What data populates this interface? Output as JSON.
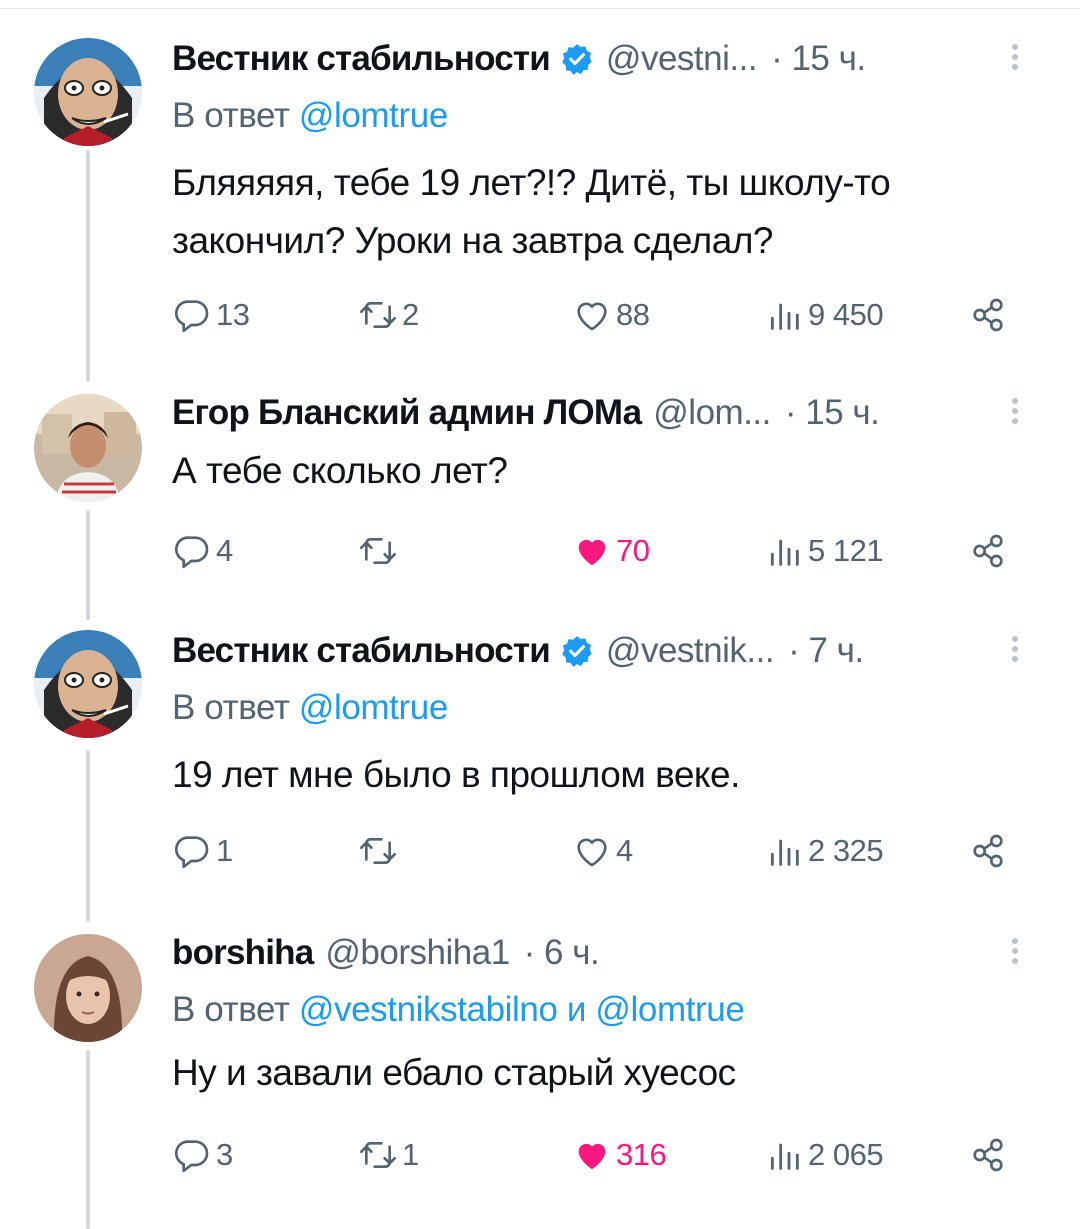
{
  "tweets": [
    {
      "name": "Вестник стабильности",
      "verified": true,
      "handle": "@vestni...",
      "time": "· 15 ч.",
      "reply_prefix": "В ответ",
      "reply_mentions": "@lomtrue",
      "reply_joiner": "",
      "reply_mentions_2": "",
      "text": "Бляяяяя, тебе 19 лет?!? Дитё, ты школу-то закончил? Уроки на завтра сделал?",
      "replies": "13",
      "retweets": "2",
      "likes": "88",
      "liked": false,
      "views": "9 450",
      "avatar": "cartoon-caricature"
    },
    {
      "name": "Егор Бланский админ ЛОМа",
      "verified": false,
      "handle": "@lom...",
      "time": "· 15 ч.",
      "reply_prefix": "",
      "reply_mentions": "",
      "text": "А тебе сколько лет?",
      "replies": "4",
      "retweets": "",
      "likes": "70",
      "liked": true,
      "views": "5 121",
      "avatar": "photo-man"
    },
    {
      "name": "Вестник стабильности",
      "verified": true,
      "handle": "@vestnik...",
      "time": "· 7 ч.",
      "reply_prefix": "В ответ",
      "reply_mentions": "@lomtrue",
      "text": "19 лет мне было в прошлом веке.",
      "replies": "1",
      "retweets": "",
      "likes": "4",
      "liked": false,
      "views": "2 325",
      "avatar": "cartoon-caricature"
    },
    {
      "name": "borshiha",
      "verified": false,
      "handle": "@borshiha1",
      "time": "· 6 ч.",
      "reply_prefix": "В ответ",
      "reply_mentions": "@vestnikstabilno",
      "reply_joiner": "и",
      "reply_mentions_2": "@lomtrue",
      "text": "Ну и завали ебало старый хуесос",
      "replies": "3",
      "retweets": "1",
      "likes": "316",
      "liked": true,
      "views": "2 065",
      "avatar": "photo-girl"
    }
  ],
  "icons": {
    "reply": "reply-icon",
    "retweet": "retweet-icon",
    "like": "heart-icon",
    "views": "views-icon",
    "share": "share-icon",
    "more": "more-icon",
    "verified": "verified-badge-icon"
  },
  "colors": {
    "text": "#0f1419",
    "secondary": "#536471",
    "link": "#1d9bf0",
    "like": "#f91880",
    "thread_line": "#cfd9de"
  }
}
